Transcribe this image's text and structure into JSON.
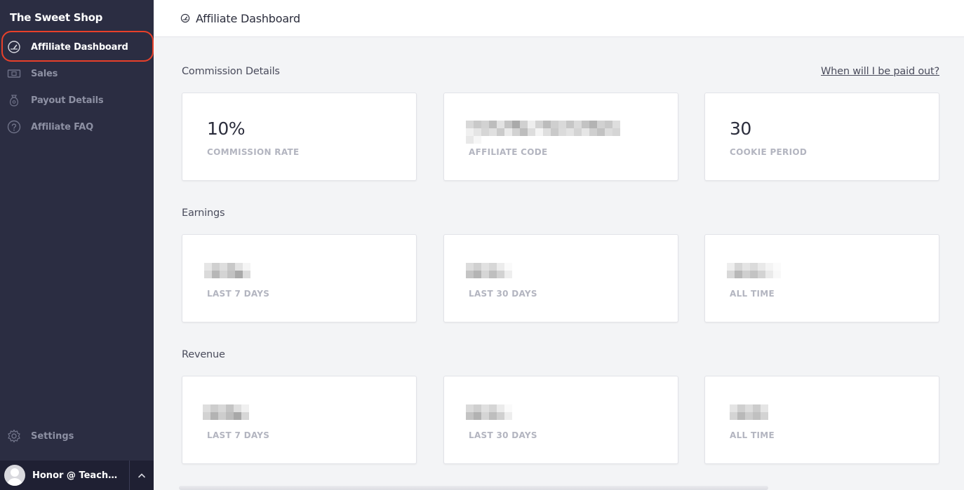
{
  "sidebar": {
    "school_name": "The Sweet Shop",
    "items": [
      {
        "label": "Affiliate Dashboard",
        "icon": "gauge-icon",
        "active": true
      },
      {
        "label": "Sales",
        "icon": "money-icon"
      },
      {
        "label": "Payout Details",
        "icon": "money-bag-icon"
      },
      {
        "label": "Affiliate FAQ",
        "icon": "question-icon"
      }
    ],
    "settings_label": "Settings",
    "user_name": "Honor @ Teachable"
  },
  "header": {
    "title": "Affiliate Dashboard"
  },
  "commission": {
    "title": "Commission Details",
    "payout_link": "When will I be paid out?",
    "cards": [
      {
        "value": "10%",
        "label": "COMMISSION RATE"
      },
      {
        "value": "",
        "label": "AFFILIATE CODE"
      },
      {
        "value": "30",
        "label": "COOKIE PERIOD"
      }
    ]
  },
  "earnings": {
    "title": "Earnings",
    "cards": [
      {
        "label": "LAST 7 DAYS"
      },
      {
        "label": "LAST 30 DAYS"
      },
      {
        "label": "ALL TIME"
      }
    ]
  },
  "revenue": {
    "title": "Revenue",
    "cards": [
      {
        "label": "LAST 7 DAYS"
      },
      {
        "label": "LAST 30 DAYS"
      },
      {
        "label": "ALL TIME"
      }
    ]
  },
  "colors": {
    "sidebar_bg": "#2b2d42",
    "highlight": "#e8402a",
    "content_bg": "#f3f4f6"
  }
}
